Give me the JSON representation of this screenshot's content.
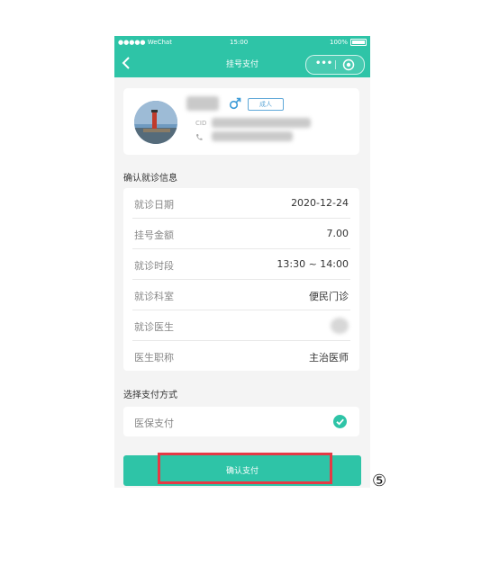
{
  "status_bar": {
    "carrier": "●●●●● WeChat",
    "time": "15:00",
    "battery": "100%"
  },
  "nav": {
    "title": "挂号支付"
  },
  "profile": {
    "gender_symbol": "♂",
    "badge": "成人",
    "id_prefix": "CID"
  },
  "visit_section": {
    "title": "确认就诊信息",
    "rows": [
      {
        "label": "就诊日期",
        "value": "2020-12-24"
      },
      {
        "label": "挂号金额",
        "value": "7.00"
      },
      {
        "label": "就诊时段",
        "value": "13:30 ~ 14:00"
      },
      {
        "label": "就诊科室",
        "value": "便民门诊"
      },
      {
        "label": "就诊医生",
        "value": ""
      },
      {
        "label": "医生职称",
        "value": "主治医师"
      }
    ]
  },
  "payment_section": {
    "title": "选择支付方式",
    "option": "医保支付"
  },
  "confirm_button": {
    "label": "确认支付"
  },
  "step_marker": "⑤",
  "colors": {
    "theme": "#2ec4a7",
    "highlight": "#e53945",
    "badge": "#5fa8d8"
  }
}
